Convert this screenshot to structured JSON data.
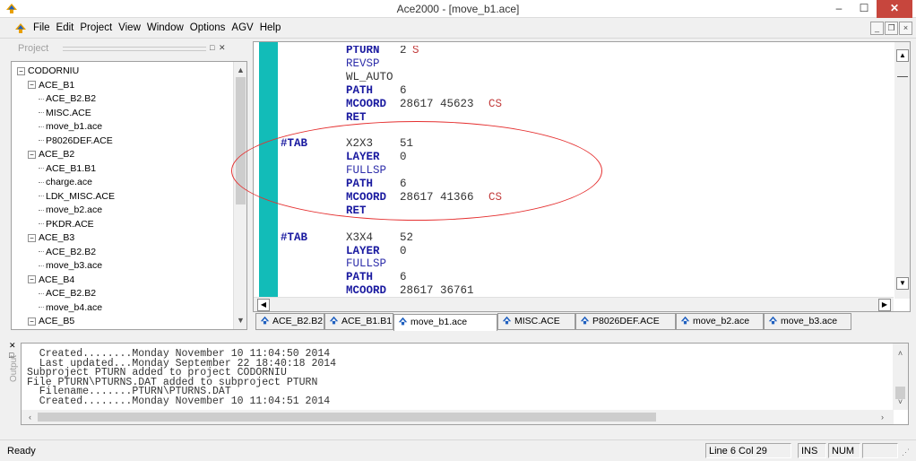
{
  "window": {
    "title": "Ace2000 - [move_b1.ace]",
    "minimize_glyph": "–",
    "maximize_glyph": "☐",
    "close_glyph": "✕",
    "app_icon": "spade-icon",
    "accent_close": "#c7463d"
  },
  "menu": {
    "items": [
      "File",
      "Edit",
      "Project",
      "View",
      "Window",
      "Options",
      "AGV",
      "Help"
    ],
    "mdi_minimize": "_",
    "mdi_restore": "❐",
    "mdi_close": "×"
  },
  "project": {
    "title": "Project",
    "tree": [
      {
        "label": "CODORNIU",
        "level": 0,
        "toggle": "−"
      },
      {
        "label": "ACE_B1",
        "level": 1,
        "toggle": "−"
      },
      {
        "label": "ACE_B2.B2",
        "level": 2
      },
      {
        "label": "MISC.ACE",
        "level": 2
      },
      {
        "label": "move_b1.ace",
        "level": 2
      },
      {
        "label": "P8026DEF.ACE",
        "level": 2
      },
      {
        "label": "ACE_B2",
        "level": 1,
        "toggle": "−"
      },
      {
        "label": "ACE_B1.B1",
        "level": 2
      },
      {
        "label": "charge.ace",
        "level": 2
      },
      {
        "label": "LDK_MISC.ACE",
        "level": 2
      },
      {
        "label": "move_b2.ace",
        "level": 2
      },
      {
        "label": "PKDR.ACE",
        "level": 2
      },
      {
        "label": "ACE_B3",
        "level": 1,
        "toggle": "−"
      },
      {
        "label": "ACE_B2.B2",
        "level": 2
      },
      {
        "label": "move_b3.ace",
        "level": 2
      },
      {
        "label": "ACE_B4",
        "level": 1,
        "toggle": "−"
      },
      {
        "label": "ACE_B2.B2",
        "level": 2
      },
      {
        "label": "move_b4.ace",
        "level": 2
      },
      {
        "label": "ACE_B5",
        "level": 1,
        "toggle": "−"
      }
    ]
  },
  "editor": {
    "lines": [
      {
        "label": "",
        "kw": "PTURN",
        "kwstyle": "bold",
        "val": "2",
        "suffix": "S"
      },
      {
        "label": "",
        "kw": "REVSP",
        "kwstyle": "thin",
        "val": "",
        "suffix": ""
      },
      {
        "label": "",
        "kw": "WL_AUTO",
        "kwstyle": "plain",
        "val": "",
        "suffix": ""
      },
      {
        "label": "",
        "kw": "PATH",
        "kwstyle": "bold",
        "val": "6",
        "suffix": ""
      },
      {
        "label": "",
        "kw": "MCOORD",
        "kwstyle": "bold",
        "val": "28617 45623",
        "suffix": "CS"
      },
      {
        "label": "",
        "kw": "RET",
        "kwstyle": "bold",
        "val": "",
        "suffix": ""
      },
      {
        "label": "",
        "kw": "",
        "kwstyle": "bold",
        "val": "",
        "suffix": ""
      },
      {
        "label": "#TAB",
        "kw": "X2X3",
        "kwstyle": "plain",
        "val": "51",
        "suffix": ""
      },
      {
        "label": "",
        "kw": "LAYER",
        "kwstyle": "bold",
        "val": "0",
        "suffix": ""
      },
      {
        "label": "",
        "kw": "FULLSP",
        "kwstyle": "thin",
        "val": "",
        "suffix": ""
      },
      {
        "label": "",
        "kw": "PATH",
        "kwstyle": "bold",
        "val": "6",
        "suffix": ""
      },
      {
        "label": "",
        "kw": "MCOORD",
        "kwstyle": "bold",
        "val": "28617 41366",
        "suffix": "CS"
      },
      {
        "label": "",
        "kw": "RET",
        "kwstyle": "bold",
        "val": "",
        "suffix": ""
      },
      {
        "label": "",
        "kw": "",
        "kwstyle": "bold",
        "val": "",
        "suffix": ""
      },
      {
        "label": "#TAB",
        "kw": "X3X4",
        "kwstyle": "plain",
        "val": "52",
        "suffix": ""
      },
      {
        "label": "",
        "kw": "LAYER",
        "kwstyle": "bold",
        "val": "0",
        "suffix": ""
      },
      {
        "label": "",
        "kw": "FULLSP",
        "kwstyle": "thin",
        "val": "",
        "suffix": ""
      },
      {
        "label": "",
        "kw": "PATH",
        "kwstyle": "bold",
        "val": "6",
        "suffix": ""
      },
      {
        "label": "",
        "kw": "MCOORD",
        "kwstyle": "bold",
        "val": "28617 36761",
        "suffix": ""
      }
    ],
    "margin_color": "#12bcb8",
    "annotation_color": "#e53030"
  },
  "tabs": [
    {
      "label": "ACE_B2.B2",
      "active": false
    },
    {
      "label": "ACE_B1.B1",
      "active": false
    },
    {
      "label": "move_b1.ace",
      "active": true
    },
    {
      "label": "MISC.ACE",
      "active": false
    },
    {
      "label": "P8026DEF.ACE",
      "active": false
    },
    {
      "label": "move_b2.ace",
      "active": false
    },
    {
      "label": "move_b3.ace",
      "active": false
    }
  ],
  "output": {
    "title": "Output",
    "lines": [
      "  Created........Monday November 10 11:04:50 2014",
      "  Last updated...Monday September 22 18:40:18 2014",
      "Subproject PTURN added to project CODORNIU",
      "File PTURN\\PTURNS.DAT added to subproject PTURN",
      "  Filename.......PTURN\\PTURNS.DAT",
      "  Created........Monday November 10 11:04:51 2014"
    ]
  },
  "status": {
    "text": "Ready",
    "position": "Line 6 Col 29",
    "ins": "INS",
    "num": "NUM"
  }
}
